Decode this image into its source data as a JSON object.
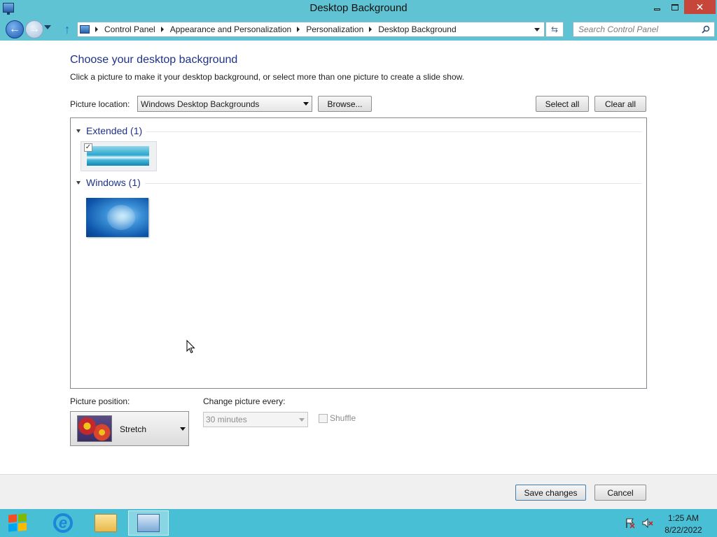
{
  "window": {
    "title": "Desktop Background",
    "close_glyph": "✕"
  },
  "nav": {
    "breadcrumbs": [
      "Control Panel",
      "Appearance and Personalization",
      "Personalization",
      "Desktop Background"
    ],
    "search_placeholder": "Search Control Panel"
  },
  "main": {
    "heading": "Choose your desktop background",
    "subtext": "Click a picture to make it your desktop background, or select more than one picture to create a slide show.",
    "picture_location_label": "Picture location:",
    "picture_location_value": "Windows Desktop Backgrounds",
    "browse_label": "Browse...",
    "select_all_label": "Select all",
    "clear_all_label": "Clear all",
    "groups": [
      {
        "title": "Extended (1)",
        "thumbnail_checked": true
      },
      {
        "title": "Windows (1)",
        "thumbnail_checked": false
      }
    ],
    "picture_position_label": "Picture position:",
    "picture_position_value": "Stretch",
    "change_picture_label": "Change picture every:",
    "change_picture_value": "30 minutes",
    "shuffle_label": "Shuffle"
  },
  "footer": {
    "save_label": "Save changes",
    "cancel_label": "Cancel"
  },
  "taskbar": {
    "time": "1:25 AM",
    "date": "8/22/2022",
    "accent": "#49bfd6"
  }
}
